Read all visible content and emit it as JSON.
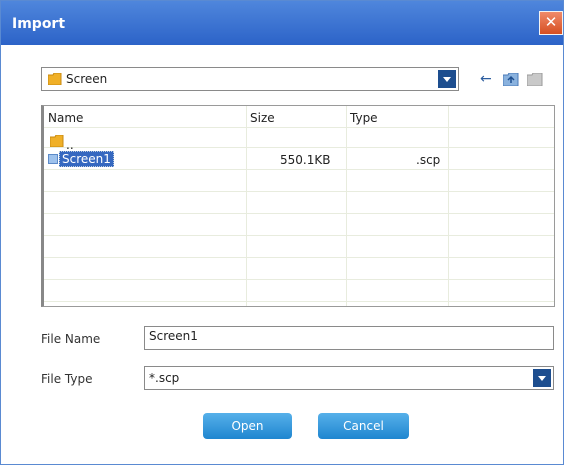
{
  "window": {
    "title": "Import",
    "close_glyph": "✕"
  },
  "location": {
    "folder": "Screen",
    "icons": [
      "back-arrow-icon",
      "up-folder-icon",
      "new-folder-icon"
    ]
  },
  "filelist": {
    "columns": [
      "Name",
      "Size",
      "Type"
    ],
    "rows": [
      {
        "name": "..",
        "size": "",
        "type": "",
        "icon": "folder-icon"
      },
      {
        "name": "Screen1",
        "size": "550.1KB",
        "type": ".scp",
        "icon": "file-icon",
        "selected": true
      }
    ]
  },
  "form": {
    "file_name_label": "File Name",
    "file_name_value": "Screen1",
    "file_type_label": "File Type",
    "file_type_value": "*.scp"
  },
  "buttons": {
    "open": "Open",
    "cancel": "Cancel"
  },
  "colors": {
    "titlebar": "#2c63c8",
    "button": "#1f86d0",
    "selection": "#3568c0"
  }
}
